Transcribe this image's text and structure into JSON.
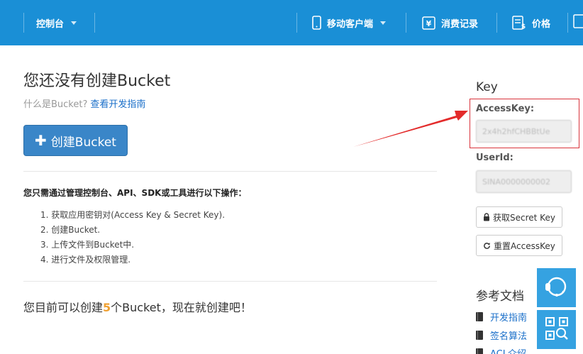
{
  "header": {
    "console_label": "控制台",
    "mobile_label": "移动客户端",
    "billing_label": "消费记录",
    "price_label": "价格"
  },
  "main": {
    "title": "您还没有创建Bucket",
    "what_is": "什么是Bucket?",
    "dev_guide_link": "查看开发指南",
    "create_button": "创建Bucket",
    "intro": "您只需通过管理控制台、API、SDK或工具进行以下操作：",
    "steps": [
      "1. 获取应用密钥对(Access Key & Secret Key).",
      "2. 创建Bucket.",
      "3. 上传文件到Bucket中.",
      "4. 进行文件及权限管理."
    ],
    "can_create_prefix": "您目前可以创建",
    "can_create_count": "5",
    "can_create_suffix": "个Bucket，现在就创建吧！"
  },
  "sidebar": {
    "title": "Key",
    "access_key_label": "AccessKey:",
    "access_key_value": "2x4h2hfCHBBtUe",
    "user_id_label": "UserId:",
    "user_id_value": "SINA0000000002",
    "get_secret_button": "获取Secret Key",
    "reset_access_button": "重置AccessKey",
    "ref_title": "参考文档",
    "ref_items": [
      "开发指南",
      "签名算法",
      "ACL介绍"
    ]
  },
  "colors": {
    "topbar": "#1a8fd6",
    "link": "#1a6fc9",
    "primary_button": "#3a86c8",
    "highlight": "#d9333b",
    "float_widget": "#35a2e1",
    "count_accent": "#f0a030"
  }
}
